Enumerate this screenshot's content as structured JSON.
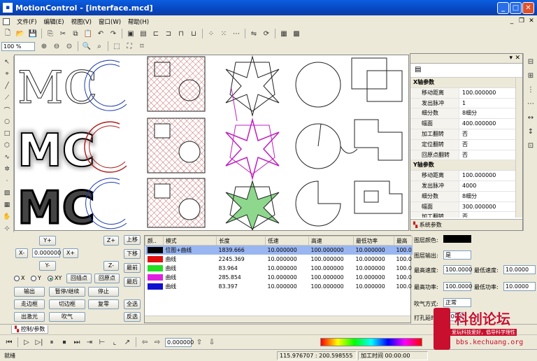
{
  "window": {
    "title": "MotionControl - [interface.mcd]"
  },
  "menu": [
    "文件(F)",
    "编辑(E)",
    "视图(V)",
    "窗口(W)",
    "帮助(H)"
  ],
  "zoom": {
    "value": "100 %"
  },
  "canvas": {
    "labels": [
      "MC",
      "MC",
      "MC"
    ]
  },
  "props": {
    "panel_title": "系统参数",
    "groups": [
      {
        "title": "X轴参数",
        "rows": [
          [
            "移动距离",
            "100.000000"
          ],
          [
            "发出脉冲",
            "1"
          ],
          [
            "细分数",
            "8细分"
          ],
          [
            "幅面",
            "400.000000"
          ],
          [
            "加工翻转",
            "否"
          ],
          [
            "定位翻转",
            "否"
          ],
          [
            "回原点翻转",
            "否"
          ]
        ]
      },
      {
        "title": "Y轴参数",
        "rows": [
          [
            "移动距离",
            "100.000000"
          ],
          [
            "发出脉冲",
            "4000"
          ],
          [
            "细分数",
            "8细分"
          ],
          [
            "幅面",
            "300.000000"
          ],
          [
            "加工翻转",
            "否"
          ]
        ]
      }
    ]
  },
  "control": {
    "y_plus": "Y+",
    "y_minus": "Y-",
    "x_minus": "X-",
    "x_plus": "X+",
    "z_plus": "Z+",
    "z_minus": "Z-",
    "step_value": "0.000000",
    "radio": [
      "X",
      "Y",
      "XY"
    ],
    "return_origin": "回插点",
    "back_origin": "回原点",
    "output": "输出",
    "pause": "暂停/继续",
    "stop": "停止",
    "frame": "走边框",
    "cut_frame": "切边框",
    "reset": "复零",
    "laser": "出激光",
    "blow": "吹气",
    "up": "上移",
    "down": "下移",
    "top": "最前",
    "bottom": "最后",
    "all": "全选",
    "invert": "反选"
  },
  "layers": {
    "headers": [
      "颜..",
      "模式",
      "长度",
      "低速",
      "高速",
      "最低功率",
      "最高"
    ],
    "rows": [
      {
        "color": "#000000",
        "mode": "位图+曲线",
        "length": "1839.666",
        "low": "10.000000",
        "high": "100.000000",
        "minp": "10.000000",
        "maxp": "100.0",
        "selected": true
      },
      {
        "color": "#e01010",
        "mode": "曲线",
        "length": "2245.369",
        "low": "10.000000",
        "high": "100.000000",
        "minp": "10.000000",
        "maxp": "100.0"
      },
      {
        "color": "#20e020",
        "mode": "曲线",
        "length": "83.964",
        "low": "10.000000",
        "high": "100.000000",
        "minp": "10.000000",
        "maxp": "100.0"
      },
      {
        "color": "#e020e0",
        "mode": "曲线",
        "length": "285.854",
        "low": "10.000000",
        "high": "100.000000",
        "minp": "10.000000",
        "maxp": "100.0"
      },
      {
        "color": "#1010d0",
        "mode": "曲线",
        "length": "83.397",
        "low": "10.000000",
        "high": "100.000000",
        "minp": "10.000000",
        "maxp": "100.0"
      }
    ]
  },
  "params": {
    "layer_color_label": "图层颜色:",
    "layer_output_label": "图层输出:",
    "layer_output_value": "是",
    "max_speed_label": "最高速度:",
    "max_speed": "100.0000",
    "min_speed_label": "最低速度:",
    "min_speed": "10.0000",
    "max_power_label": "最高功率:",
    "max_power": "100.0000",
    "min_power_label": "最低功率:",
    "min_power": "10.0000",
    "blow_label": "吹气方式:",
    "blow_value": "正常",
    "punch_label": "打孔延时:",
    "punch_value": "0.000000"
  },
  "tab": {
    "label": "控制/参数"
  },
  "bottom": {
    "value": "0.000000"
  },
  "status": {
    "ready": "就绪",
    "coords": "115.976707 : 200.598555",
    "time": "加工时间 00:00:00"
  },
  "watermark": {
    "title": "科创论坛",
    "subtitle": "爱玩科技爱好，倡导科学理性",
    "url": "bbs.kechuang.org"
  }
}
